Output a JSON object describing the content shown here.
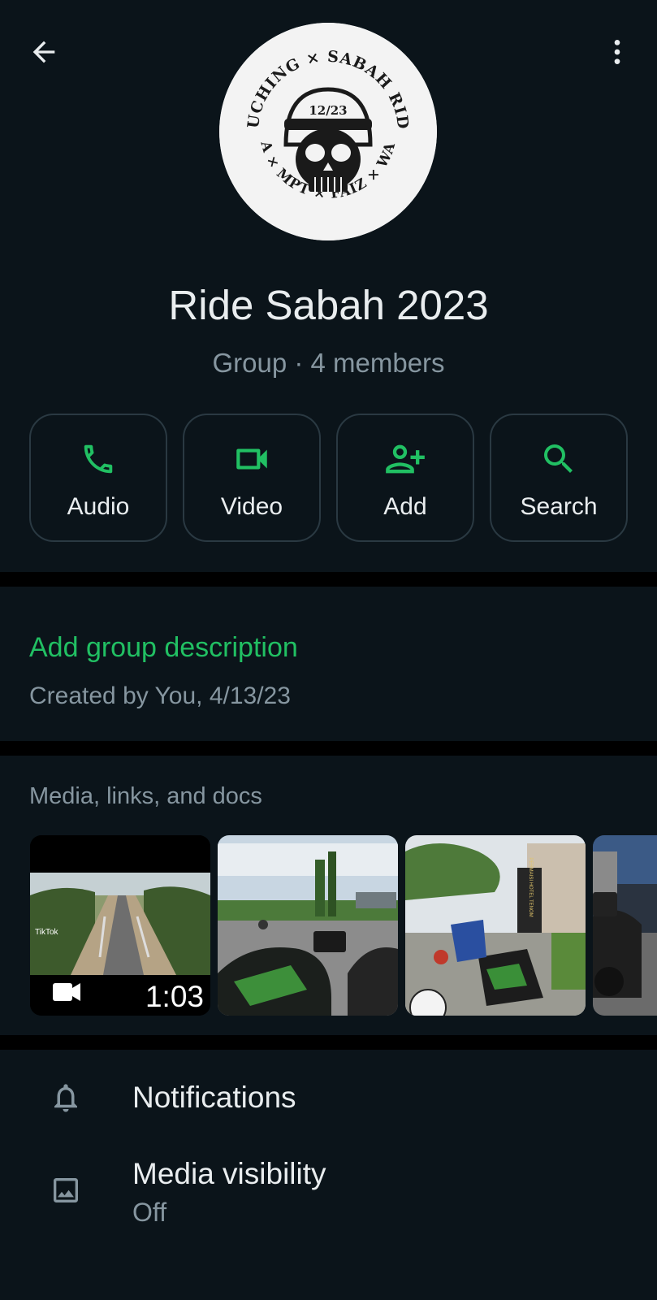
{
  "header": {
    "avatar_text_top": "KUCHING × SABAH RIDE",
    "avatar_text_date": "12/23",
    "avatar_text_bottom": "CA × MPT × FAIZ × WAD",
    "title": "Ride Sabah 2023",
    "subtitle": "Group · 4 members"
  },
  "actions": [
    {
      "label": "Audio",
      "icon": "phone-icon"
    },
    {
      "label": "Video",
      "icon": "videocam-icon"
    },
    {
      "label": "Add",
      "icon": "person-add-icon"
    },
    {
      "label": "Search",
      "icon": "search-icon"
    }
  ],
  "description": {
    "add_label": "Add group description",
    "created": "Created by You, 4/13/23"
  },
  "media": {
    "title": "Media, links, and docs",
    "items": [
      {
        "type": "video",
        "duration": "1:03",
        "overlay_text": "TikTok"
      },
      {
        "type": "image"
      },
      {
        "type": "image",
        "sign_text": "PERMAISI HOTEL TENOM"
      },
      {
        "type": "image"
      }
    ]
  },
  "settings": [
    {
      "label": "Notifications",
      "icon": "bell-icon"
    },
    {
      "label": "Media visibility",
      "value": "Off",
      "icon": "image-icon"
    }
  ],
  "colors": {
    "accent": "#21c063",
    "background": "#0b141a",
    "separator": "#000000",
    "secondary_text": "#8696a0"
  }
}
